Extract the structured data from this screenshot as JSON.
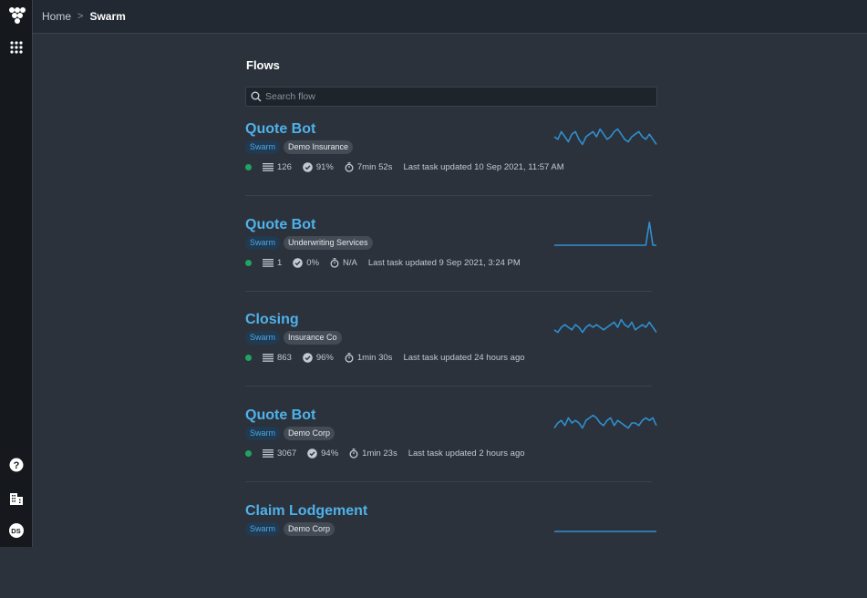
{
  "breadcrumb": {
    "home": "Home",
    "separator": ">",
    "current": "Swarm"
  },
  "sidebar": {
    "top_icons": [
      "logo-icon",
      "apps-grid-icon"
    ],
    "bottom_icons": [
      "help-icon",
      "organization-icon"
    ],
    "avatar_initials": "DS"
  },
  "main": {
    "title": "Flows",
    "search": {
      "placeholder": "Search flow",
      "value": ""
    }
  },
  "colors": {
    "link": "#4fb1ea",
    "status_green": "#1fa463",
    "sparkline": "#2f8fd0"
  },
  "flows": [
    {
      "name": "Quote Bot",
      "tags": [
        "Swarm",
        "Demo Insurance"
      ],
      "status": "active",
      "tasks": "126",
      "success": "91%",
      "duration": "7min 52s",
      "last_updated": "Last task updated 10 Sep 2021, 11:57 AM",
      "trend": [
        5,
        6,
        3,
        5,
        7,
        4,
        3,
        6,
        8,
        5,
        4,
        3,
        5,
        2,
        4,
        6,
        5,
        3,
        2,
        4,
        6,
        7,
        5,
        4,
        3,
        5,
        6,
        4,
        6,
        8
      ]
    },
    {
      "name": "Quote Bot",
      "tags": [
        "Swarm",
        "Underwriting Services"
      ],
      "status": "active",
      "tasks": "1",
      "success": "0%",
      "duration": "N/A",
      "last_updated": "Last task updated 9 Sep 2021, 3:24 PM",
      "trend": [
        10,
        10,
        10,
        10,
        10,
        10,
        10,
        10,
        10,
        10,
        10,
        10,
        10,
        10,
        10,
        10,
        10,
        10,
        10,
        10,
        10,
        10,
        10,
        10,
        10,
        10,
        10,
        1,
        10,
        10
      ]
    },
    {
      "name": "Closing",
      "tags": [
        "Swarm",
        "Insurance Co"
      ],
      "status": "active",
      "tasks": "863",
      "success": "96%",
      "duration": "1min 30s",
      "last_updated": "Last task updated 24 hours ago",
      "trend": [
        6,
        7,
        5,
        4,
        5,
        6,
        4,
        5,
        7,
        5,
        4,
        5,
        4,
        5,
        6,
        5,
        4,
        3,
        5,
        2,
        4,
        5,
        3,
        6,
        5,
        4,
        5,
        3,
        5,
        7
      ]
    },
    {
      "name": "Quote Bot",
      "tags": [
        "Swarm",
        "Demo Corp"
      ],
      "status": "active",
      "tasks": "3067",
      "success": "94%",
      "duration": "1min 23s",
      "last_updated": "Last task updated 2 hours ago",
      "trend": [
        7,
        5,
        4,
        6,
        3,
        5,
        4,
        5,
        7,
        4,
        3,
        2,
        3,
        5,
        6,
        4,
        3,
        6,
        4,
        5,
        6,
        7,
        5,
        5,
        6,
        4,
        3,
        4,
        3,
        6
      ]
    },
    {
      "name": "Claim Lodgement",
      "tags": [
        "Swarm",
        "Demo Corp"
      ],
      "status": "active",
      "tasks": "",
      "success": "",
      "duration": "",
      "last_updated": "",
      "trend": [
        10,
        10,
        10,
        10,
        10,
        10,
        10,
        10,
        10,
        10,
        10,
        10,
        10,
        10,
        10,
        10,
        10,
        10,
        10,
        10,
        10,
        10,
        10,
        10,
        10,
        10,
        10,
        10,
        10,
        10
      ]
    }
  ]
}
